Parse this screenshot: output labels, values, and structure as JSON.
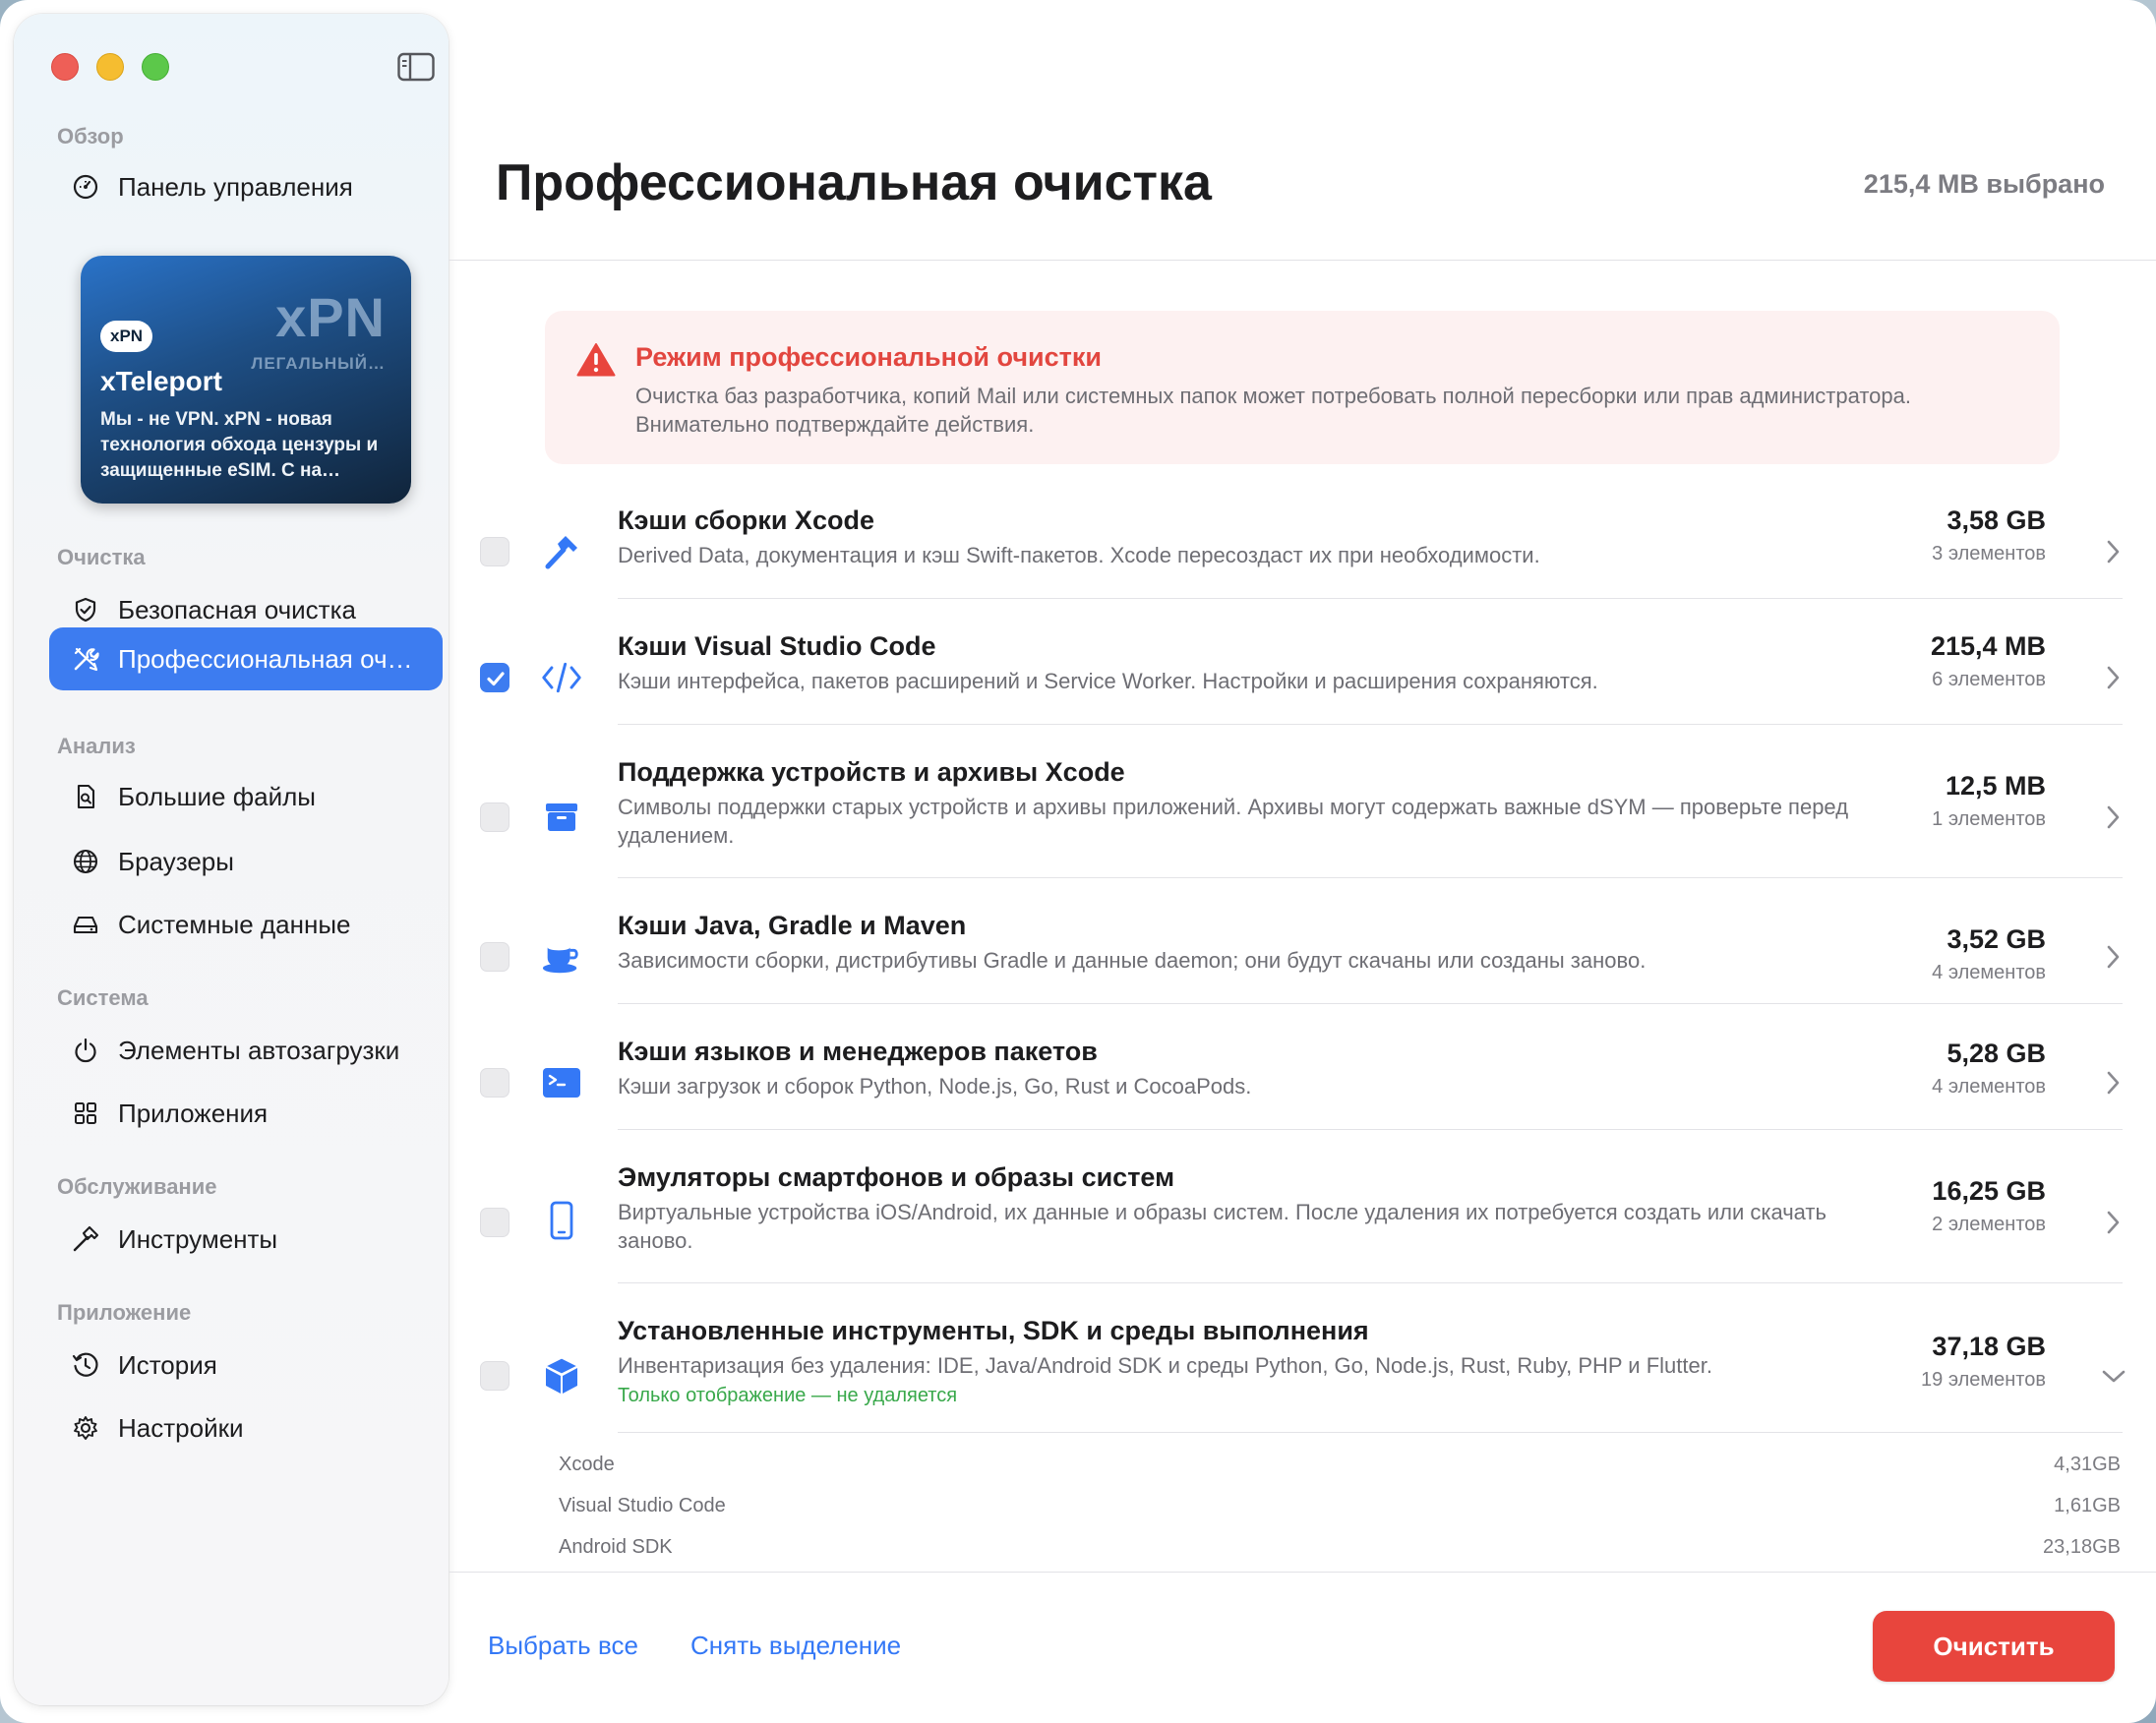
{
  "sidebar": {
    "sections": {
      "overview": "Обзор",
      "cleaning": "Очистка",
      "analysis": "Анализ",
      "system": "Система",
      "maintenance": "Обслуживание",
      "app": "Приложение"
    },
    "items": {
      "dashboard": "Панель управления",
      "safe_clean": "Безопасная очистка",
      "pro_clean": "Профессиональная очистка",
      "large_files": "Большие файлы",
      "browsers": "Браузеры",
      "system_data": "Системные данные",
      "login_items": "Элементы автозагрузки",
      "apps": "Приложения",
      "tools": "Инструменты",
      "history": "История",
      "settings": "Настройки"
    },
    "promo": {
      "logo": "xPN",
      "subtitle": "ЛЕГАЛЬНЫЙ…",
      "badge": "xPN",
      "title": "xTeleport",
      "description": "Мы - не VPN. xPN - новая технология обхода цензуры и защищенные eSIM. С на…"
    }
  },
  "header": {
    "title": "Профессиональная очистка",
    "selected_total": "215,4 MB выбрано"
  },
  "warning": {
    "title": "Режим профессиональной очистки",
    "description": "Очистка баз разработчика, копий Mail или системных папок может потребовать полной пересборки или прав администратора. Внимательно подтверждайте действия."
  },
  "rows": [
    {
      "title": "Кэши сборки Xcode",
      "description": "Derived Data, документация и кэш Swift-пакетов. Xcode пересоздаст их при необходимости.",
      "size": "3,58 GB",
      "count": "3 элементов",
      "checked": false,
      "icon": "hammer-icon"
    },
    {
      "title": "Кэши Visual Studio Code",
      "description": "Кэши интерфейса, пакетов расширений и Service Worker. Настройки и расширения сохраняются.",
      "size": "215,4 MB",
      "count": "6 элементов",
      "checked": true,
      "icon": "code-icon"
    },
    {
      "title": "Поддержка устройств и архивы Xcode",
      "description": "Символы поддержки старых устройств и архивы приложений. Архивы могут содержать важные dSYM — проверьте перед удалением.",
      "size": "12,5 MB",
      "count": "1 элементов",
      "checked": false,
      "icon": "archive-box-icon"
    },
    {
      "title": "Кэши Java, Gradle и Maven",
      "description": "Зависимости сборки, дистрибутивы Gradle и данные daemon; они будут скачаны или созданы заново.",
      "size": "3,52 GB",
      "count": "4 элементов",
      "checked": false,
      "icon": "coffee-cup-icon"
    },
    {
      "title": "Кэши языков и менеджеров пакетов",
      "description": "Кэши загрузок и сборок Python, Node.js, Go, Rust и CocoaPods.",
      "size": "5,28 GB",
      "count": "4 элементов",
      "checked": false,
      "icon": "terminal-icon"
    },
    {
      "title": "Эмуляторы смартфонов и образы систем",
      "description": "Виртуальные устройства iOS/Android, их данные и образы систем. После удаления их потребуется создать или скачать заново.",
      "size": "16,25 GB",
      "count": "2 элементов",
      "checked": false,
      "icon": "smartphone-icon"
    },
    {
      "title": "Установленные инструменты, SDK и среды выполнения",
      "description": "Инвентаризация без удаления: IDE, Java/Android SDK и среды Python, Go, Node.js, Rust, Ruby, PHP и Flutter.",
      "note": "Только отображение — не удаляется",
      "size": "37,18 GB",
      "count": "19 элементов",
      "checked": false,
      "icon": "cube-icon"
    }
  ],
  "sub_items": [
    {
      "name": "Xcode",
      "size": "4,31GB"
    },
    {
      "name": "Visual Studio Code",
      "size": "1,61GB"
    },
    {
      "name": "Android SDK",
      "size": "23,18GB"
    }
  ],
  "footer": {
    "select_all": "Выбрать все",
    "deselect": "Снять выделение",
    "clean": "Очистить"
  },
  "colors": {
    "accent": "#3d7cf0",
    "danger": "#e8453d",
    "success": "#38a84a"
  }
}
